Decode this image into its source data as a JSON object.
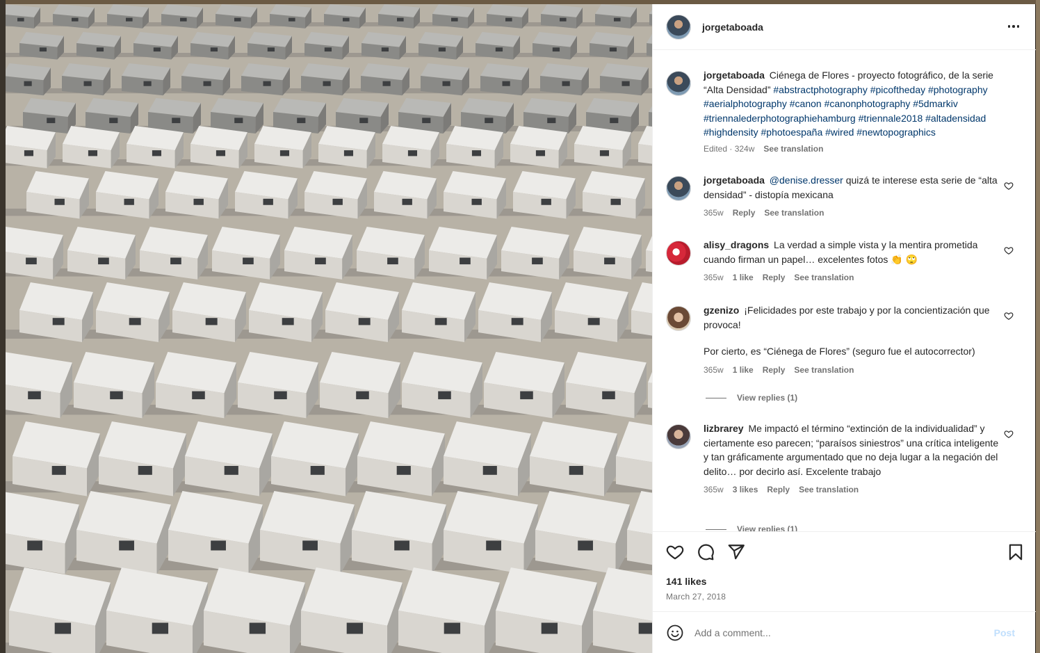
{
  "photo": {
    "icon": "aerial-housing-photo"
  },
  "post": {
    "username": "jorgetaboada",
    "more_icon": "more-options-icon"
  },
  "caption": {
    "username": "jorgetaboada",
    "text": "Ciénega de Flores - proyecto fotográfico, de la serie “Alta Densidad”",
    "hashtags": "#abstractphotography #picoftheday #photography #aerialphotography #canon #canonphotography #5dmarkiv #triennalederphotographiehamburg #triennale2018 #altadensidad #highdensity #photoespaña #wired #newtopographics",
    "meta_edited": "Edited · 324w",
    "see_translation": "See translation"
  },
  "comments": [
    {
      "username": "jorgetaboada",
      "mention": "@denise.dresser",
      "text": "quizá te interese esta serie de “alta densidad” - distopía mexicana",
      "time": "365w",
      "reply": "Reply",
      "see_translation": "See translation"
    },
    {
      "username": "alisy_dragons",
      "text": "La verdad a simple vista y la mentira prometida cuando firman un papel… excelentes fotos 👏 🙄",
      "time": "365w",
      "likes": "1 like",
      "reply": "Reply",
      "see_translation": "See translation"
    },
    {
      "username": "gzenizo",
      "text": "¡Felicidades por este trabajo y por la concientización que provoca!",
      "text2": "Por cierto, es “Ciénega de Flores” (seguro fue el autocorrector)",
      "time": "365w",
      "likes": "1 like",
      "reply": "Reply",
      "see_translation": "See translation",
      "view_replies": "View replies (1)"
    },
    {
      "username": "lizbrarey",
      "text": "Me impactó el término “extinción de la individualidad” y ciertamente eso parecen; “paraísos siniestros” una crítica inteligente y tan gráficamente argumentado que no deja lugar a la negación del delito… por decirlo así. Excelente trabajo",
      "time": "365w",
      "likes": "3 likes",
      "reply": "Reply",
      "see_translation": "See translation",
      "view_replies": "View replies (1)"
    }
  ],
  "actions": {
    "like_icon": "heart-icon",
    "comment_icon": "comment-icon",
    "share_icon": "share-icon",
    "save_icon": "bookmark-icon",
    "likes": "141 likes",
    "date": "March 27, 2018"
  },
  "add_comment": {
    "placeholder": "Add a comment...",
    "post_label": "Post",
    "emoji_icon": "emoji-icon"
  }
}
